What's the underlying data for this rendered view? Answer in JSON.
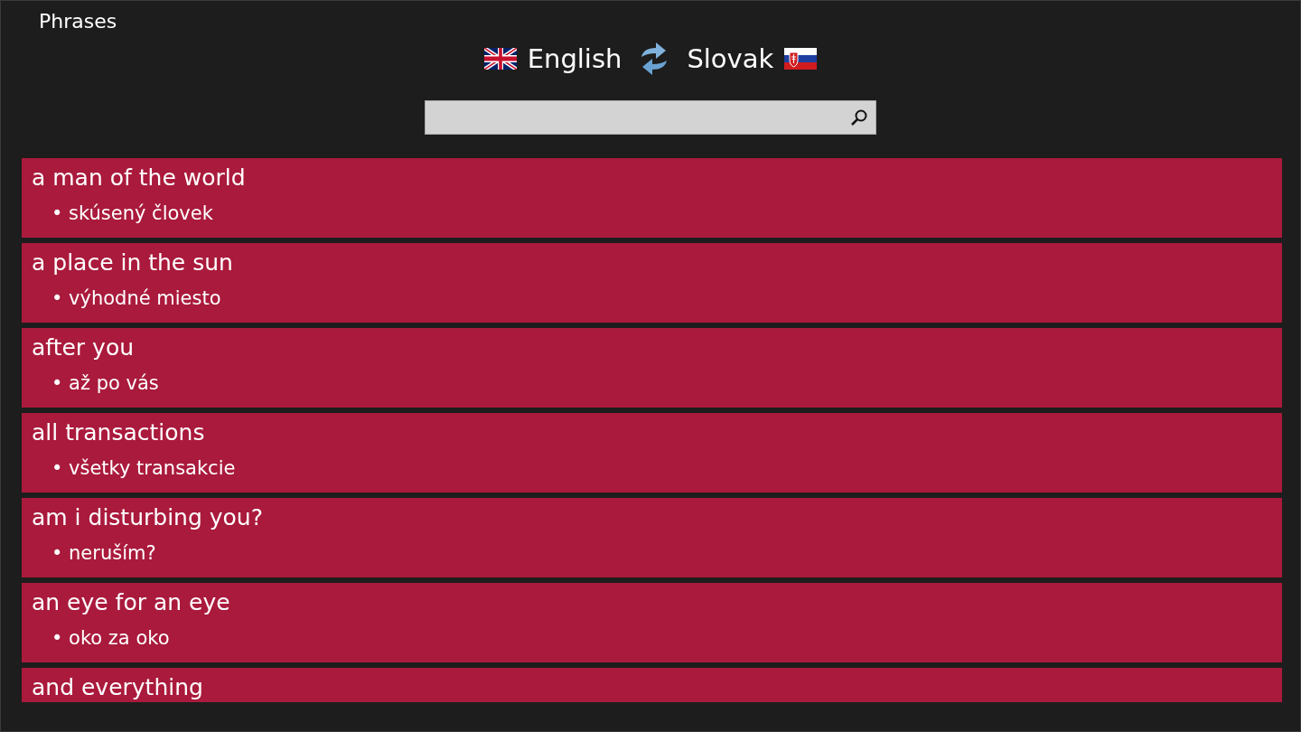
{
  "window": {
    "title": "Phrases"
  },
  "languages": {
    "source": "English",
    "target": "Slovak"
  },
  "phrases": [
    {
      "phrase": "a man of the world",
      "translations": [
        "• skúsený človek"
      ]
    },
    {
      "phrase": "a place in the sun",
      "translations": [
        "• výhodné miesto"
      ]
    },
    {
      "phrase": "after you",
      "translations": [
        "• až po vás"
      ]
    },
    {
      "phrase": "all transactions",
      "translations": [
        "• všetky transakcie"
      ]
    },
    {
      "phrase": "am i disturbing you?",
      "translations": [
        "• neruším?"
      ]
    },
    {
      "phrase": "an eye for an eye",
      "translations": [
        "• oko za oko"
      ]
    },
    {
      "phrase": "and everything"
    }
  ]
}
